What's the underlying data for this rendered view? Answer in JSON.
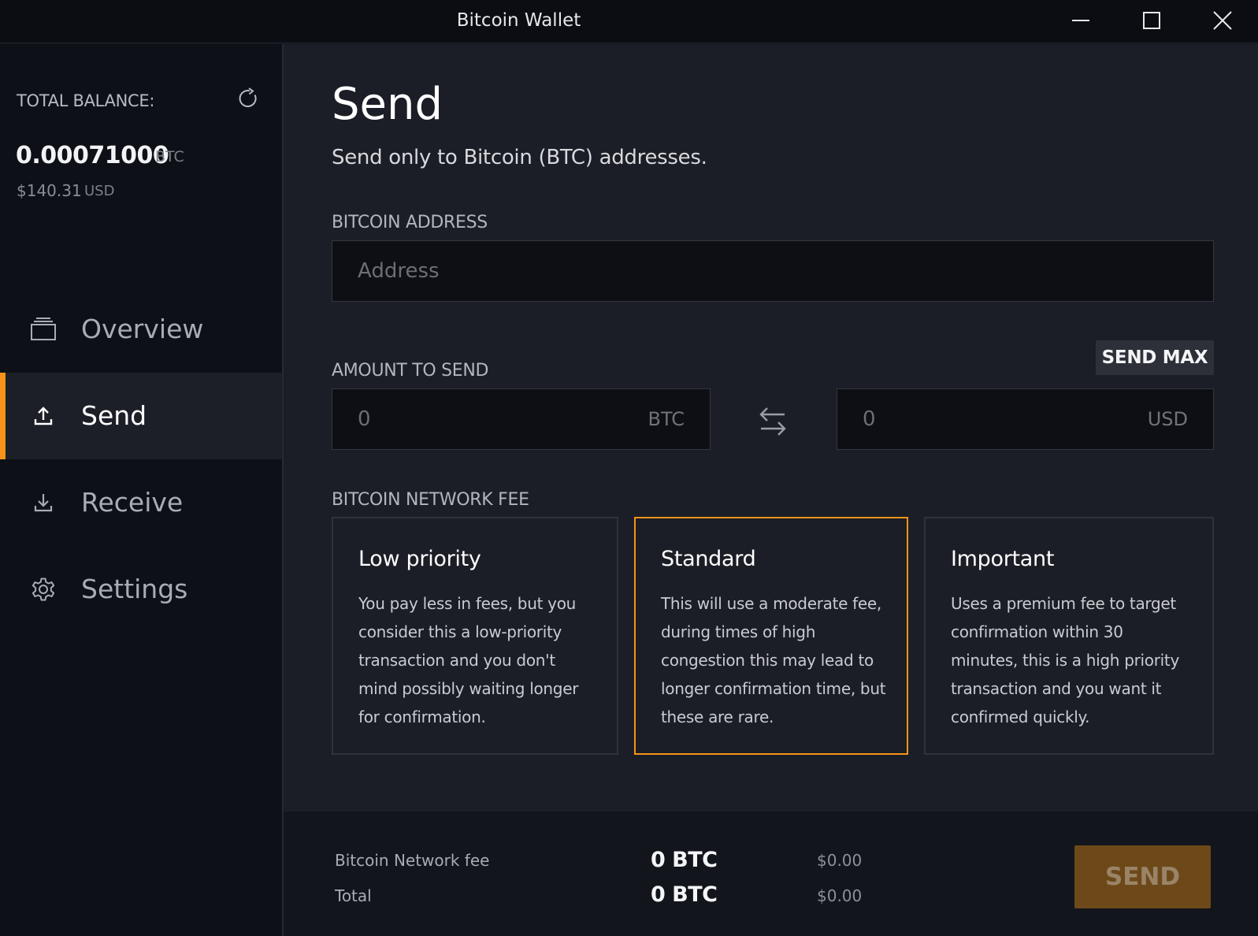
{
  "window": {
    "title": "Bitcoin Wallet",
    "controls": [
      "minimize-icon",
      "maximize-icon",
      "close-icon"
    ]
  },
  "sidebar": {
    "balance_label": "TOTAL BALANCE:",
    "btc_amount": "0.00071000",
    "btc_unit": "BTC",
    "usd_amount": "$140.31",
    "usd_unit": "USD",
    "nav": [
      {
        "label": "Overview",
        "icon": "overview-icon",
        "active": false
      },
      {
        "label": "Send",
        "icon": "upload-icon",
        "active": true
      },
      {
        "label": "Receive",
        "icon": "download-icon",
        "active": false
      },
      {
        "label": "Settings",
        "icon": "gear-icon",
        "active": false
      }
    ]
  },
  "send": {
    "title": "Send",
    "subtitle": "Send only to Bitcoin (BTC) addresses.",
    "address_label": "BITCOIN ADDRESS",
    "address_placeholder": "Address",
    "amount_label": "AMOUNT TO SEND",
    "send_max_label": "SEND MAX",
    "btc_placeholder": "0",
    "btc_unit": "BTC",
    "usd_placeholder": "0",
    "usd_unit": "USD",
    "fee_label": "BITCOIN NETWORK FEE",
    "fees": [
      {
        "title": "Low priority",
        "description": "You pay less in fees, but you consider this a low-priority transaction and you don't mind possibly waiting longer for confirmation.",
        "selected": false
      },
      {
        "title": "Standard",
        "description": "This will use a moderate fee, during times of high congestion this may lead to longer confirmation time, but these are rare.",
        "selected": true
      },
      {
        "title": "Important",
        "description": "Uses a premium fee to target confirmation within 30 minutes, this is a high priority transaction and you want it confirmed quickly.",
        "selected": false
      }
    ]
  },
  "summary": {
    "fee_label": "Bitcoin Network fee",
    "fee_btc": "0 BTC",
    "fee_usd": "$0.00",
    "total_label": "Total",
    "total_btc": "0 BTC",
    "total_usd": "$0.00",
    "send_button": "SEND"
  },
  "colors": {
    "accent": "#f7931a",
    "send_button_bg": "#6d4919",
    "background": "#1b1e26",
    "sidebar": "#0e1017"
  }
}
